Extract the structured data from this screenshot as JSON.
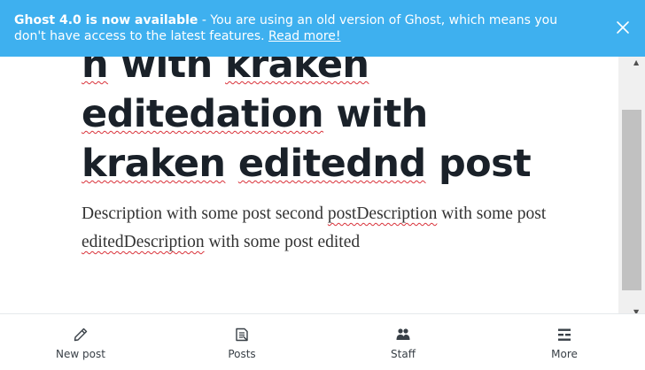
{
  "editor": {
    "title_parts": [
      {
        "text": "h",
        "spell": true
      },
      {
        "text": " with ",
        "spell": false
      },
      {
        "text": "kraken",
        "spell": true
      },
      {
        "text": " ",
        "spell": false
      },
      {
        "text": "editedation",
        "spell": true
      },
      {
        "text": " with ",
        "spell": false
      },
      {
        "text": "kraken",
        "spell": true
      },
      {
        "text": " ",
        "spell": false
      },
      {
        "text": "editednd",
        "spell": true
      },
      {
        "text": " post",
        "spell": false
      }
    ],
    "body_parts": [
      {
        "text": "Description with some post second ",
        "spell": false
      },
      {
        "text": "postDescription",
        "spell": true
      },
      {
        "text": " with some post ",
        "spell": false
      },
      {
        "text": "editedDescription",
        "spell": true
      },
      {
        "text": " with some post edited",
        "spell": false
      }
    ]
  },
  "banner": {
    "headline": "Ghost 4.0 is now available",
    "message": " - You are using an old version of Ghost, which means you don't have access to the latest features. ",
    "link": "Read more!",
    "color": "#3eb0ef"
  },
  "bottom_nav": {
    "items": [
      {
        "label": "New post",
        "icon": "pencil-icon"
      },
      {
        "label": "Posts",
        "icon": "posts-icon"
      },
      {
        "label": "Staff",
        "icon": "staff-icon"
      },
      {
        "label": "More",
        "icon": "more-icon"
      }
    ]
  }
}
